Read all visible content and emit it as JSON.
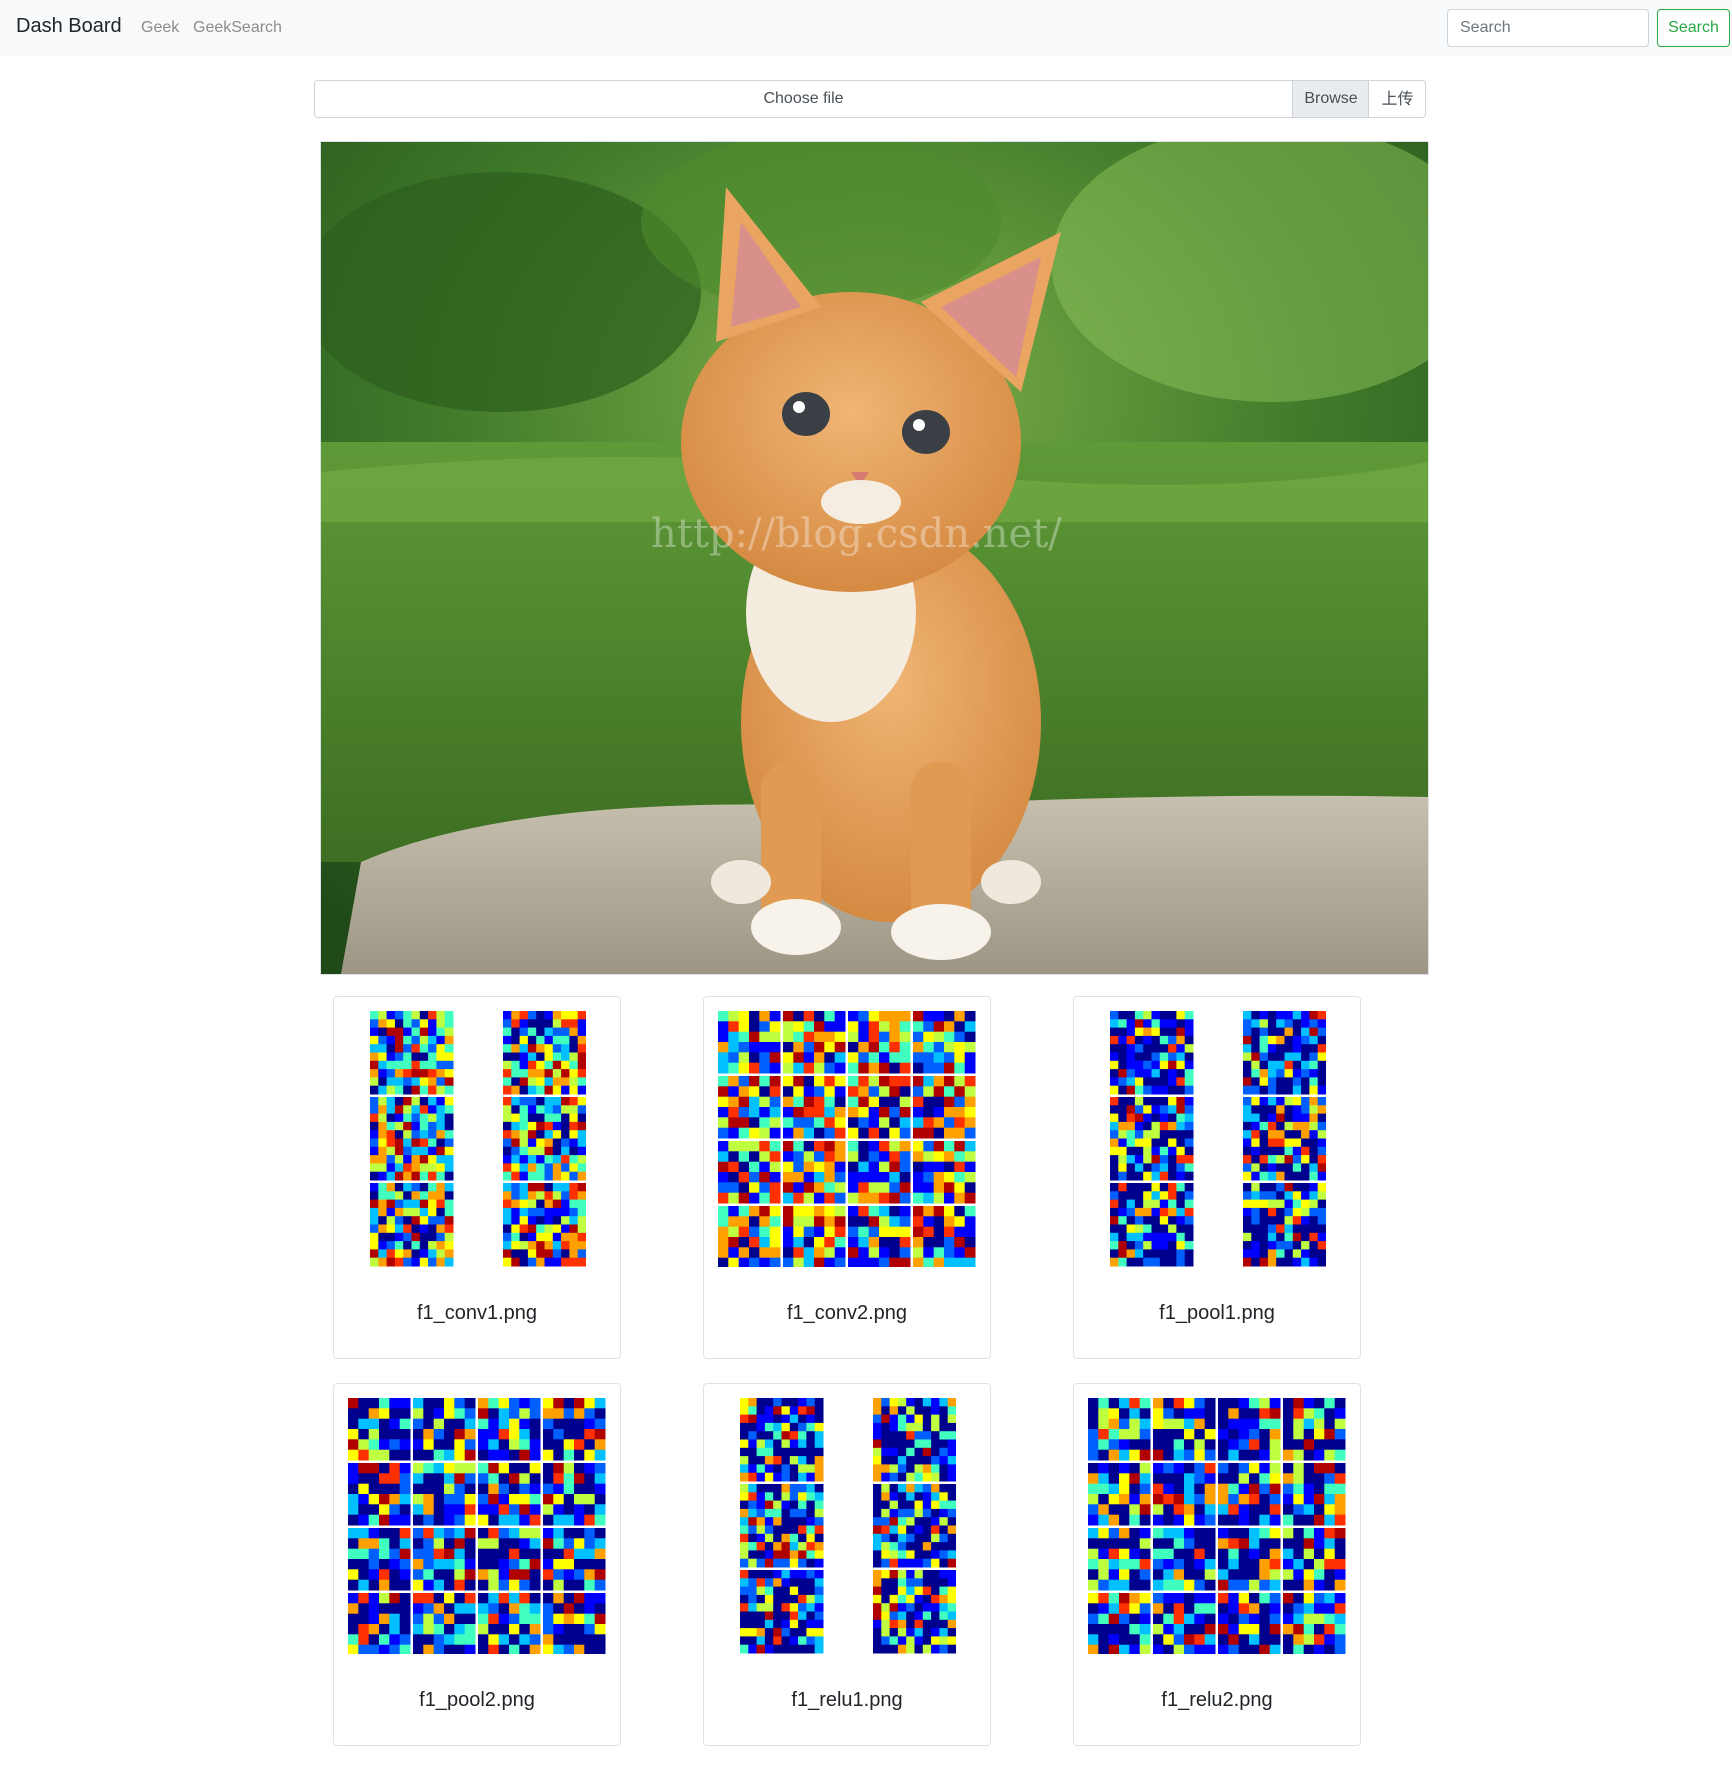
{
  "navbar": {
    "brand": "Dash Board",
    "links": [
      "Geek",
      "GeekSearch"
    ],
    "search_placeholder": "Search",
    "search_button": "Search",
    "search_button_color": "#28a745"
  },
  "upload": {
    "file_label": "Choose file",
    "browse_label": "Browse",
    "upload_label": "上传"
  },
  "main_image": {
    "subject": "orange kitten on rock with grass background",
    "watermark": "http://blog.csdn.net/"
  },
  "feature_maps": [
    {
      "title": "f1_conv1.png",
      "layout": "2x3 grid, 6 maps"
    },
    {
      "title": "f1_conv2.png",
      "layout": "4x4 grid, 16 maps"
    },
    {
      "title": "f1_pool1.png",
      "layout": "2x3 grid, 6 maps"
    },
    {
      "title": "f1_pool2.png",
      "layout": "4x4 grid, 16 maps"
    },
    {
      "title": "f1_relu1.png",
      "layout": "2x3 grid, 6 maps"
    },
    {
      "title": "f1_relu2.png",
      "layout": "4x4 grid, 16 maps"
    }
  ]
}
